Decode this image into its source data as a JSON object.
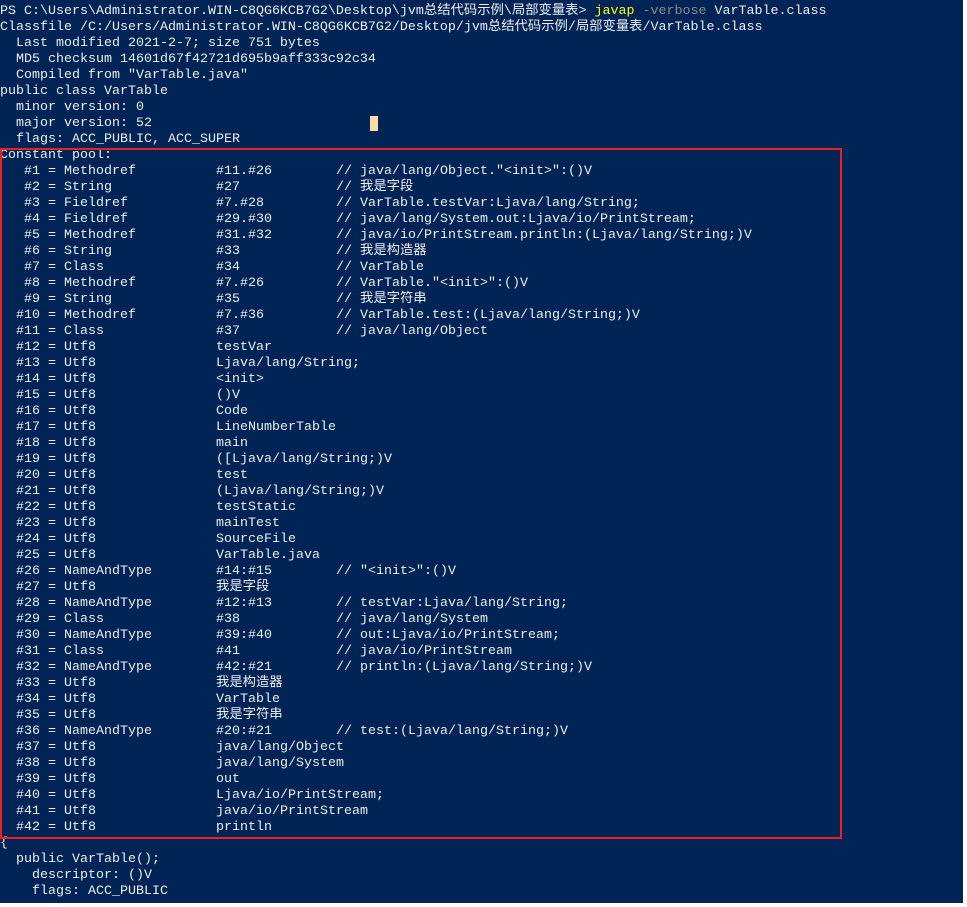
{
  "terminal": {
    "prompt": "PS C:\\Users\\Administrator.WIN-C8QG6KCB7G2\\Desktop\\jvm总结代码示例\\局部变量表> ",
    "command": "javap",
    "flag": "-verbose",
    "argument": "VarTable.class",
    "colors": {
      "background": "#012456",
      "command": "#ffff00",
      "flag": "#8a8a8a",
      "highlight_box": "#e8231f"
    },
    "header_lines": [
      "Classfile /C:/Users/Administrator.WIN-C8QG6KCB7G2/Desktop/jvm总结代码示例/局部变量表/VarTable.class",
      "  Last modified 2021-2-7; size 751 bytes",
      "  MD5 checksum 14601d67f42721d695b9aff333c92c34",
      "  Compiled from \"VarTable.java\"",
      "public class VarTable",
      "  minor version: 0",
      "  major version: 52",
      "  flags: ACC_PUBLIC, ACC_SUPER",
      "Constant pool:"
    ],
    "constant_pool": [
      {
        "idx": "#1",
        "type": "Methodref",
        "ref": "#11.#26",
        "comment": "// java/lang/Object.\"<init>\":()V"
      },
      {
        "idx": "#2",
        "type": "String",
        "ref": "#27",
        "comment": "// 我是字段"
      },
      {
        "idx": "#3",
        "type": "Fieldref",
        "ref": "#7.#28",
        "comment": "// VarTable.testVar:Ljava/lang/String;"
      },
      {
        "idx": "#4",
        "type": "Fieldref",
        "ref": "#29.#30",
        "comment": "// java/lang/System.out:Ljava/io/PrintStream;"
      },
      {
        "idx": "#5",
        "type": "Methodref",
        "ref": "#31.#32",
        "comment": "// java/io/PrintStream.println:(Ljava/lang/String;)V"
      },
      {
        "idx": "#6",
        "type": "String",
        "ref": "#33",
        "comment": "// 我是构造器"
      },
      {
        "idx": "#7",
        "type": "Class",
        "ref": "#34",
        "comment": "// VarTable"
      },
      {
        "idx": "#8",
        "type": "Methodref",
        "ref": "#7.#26",
        "comment": "// VarTable.\"<init>\":()V"
      },
      {
        "idx": "#9",
        "type": "String",
        "ref": "#35",
        "comment": "// 我是字符串"
      },
      {
        "idx": "#10",
        "type": "Methodref",
        "ref": "#7.#36",
        "comment": "// VarTable.test:(Ljava/lang/String;)V"
      },
      {
        "idx": "#11",
        "type": "Class",
        "ref": "#37",
        "comment": "// java/lang/Object"
      },
      {
        "idx": "#12",
        "type": "Utf8",
        "ref": "testVar",
        "comment": ""
      },
      {
        "idx": "#13",
        "type": "Utf8",
        "ref": "Ljava/lang/String;",
        "comment": ""
      },
      {
        "idx": "#14",
        "type": "Utf8",
        "ref": "<init>",
        "comment": ""
      },
      {
        "idx": "#15",
        "type": "Utf8",
        "ref": "()V",
        "comment": ""
      },
      {
        "idx": "#16",
        "type": "Utf8",
        "ref": "Code",
        "comment": ""
      },
      {
        "idx": "#17",
        "type": "Utf8",
        "ref": "LineNumberTable",
        "comment": ""
      },
      {
        "idx": "#18",
        "type": "Utf8",
        "ref": "main",
        "comment": ""
      },
      {
        "idx": "#19",
        "type": "Utf8",
        "ref": "([Ljava/lang/String;)V",
        "comment": ""
      },
      {
        "idx": "#20",
        "type": "Utf8",
        "ref": "test",
        "comment": ""
      },
      {
        "idx": "#21",
        "type": "Utf8",
        "ref": "(Ljava/lang/String;)V",
        "comment": ""
      },
      {
        "idx": "#22",
        "type": "Utf8",
        "ref": "testStatic",
        "comment": ""
      },
      {
        "idx": "#23",
        "type": "Utf8",
        "ref": "mainTest",
        "comment": ""
      },
      {
        "idx": "#24",
        "type": "Utf8",
        "ref": "SourceFile",
        "comment": ""
      },
      {
        "idx": "#25",
        "type": "Utf8",
        "ref": "VarTable.java",
        "comment": ""
      },
      {
        "idx": "#26",
        "type": "NameAndType",
        "ref": "#14:#15",
        "comment": "// \"<init>\":()V"
      },
      {
        "idx": "#27",
        "type": "Utf8",
        "ref": "我是字段",
        "comment": ""
      },
      {
        "idx": "#28",
        "type": "NameAndType",
        "ref": "#12:#13",
        "comment": "// testVar:Ljava/lang/String;"
      },
      {
        "idx": "#29",
        "type": "Class",
        "ref": "#38",
        "comment": "// java/lang/System"
      },
      {
        "idx": "#30",
        "type": "NameAndType",
        "ref": "#39:#40",
        "comment": "// out:Ljava/io/PrintStream;"
      },
      {
        "idx": "#31",
        "type": "Class",
        "ref": "#41",
        "comment": "// java/io/PrintStream"
      },
      {
        "idx": "#32",
        "type": "NameAndType",
        "ref": "#42:#21",
        "comment": "// println:(Ljava/lang/String;)V"
      },
      {
        "idx": "#33",
        "type": "Utf8",
        "ref": "我是构造器",
        "comment": ""
      },
      {
        "idx": "#34",
        "type": "Utf8",
        "ref": "VarTable",
        "comment": ""
      },
      {
        "idx": "#35",
        "type": "Utf8",
        "ref": "我是字符串",
        "comment": ""
      },
      {
        "idx": "#36",
        "type": "NameAndType",
        "ref": "#20:#21",
        "comment": "// test:(Ljava/lang/String;)V"
      },
      {
        "idx": "#37",
        "type": "Utf8",
        "ref": "java/lang/Object",
        "comment": ""
      },
      {
        "idx": "#38",
        "type": "Utf8",
        "ref": "java/lang/System",
        "comment": ""
      },
      {
        "idx": "#39",
        "type": "Utf8",
        "ref": "out",
        "comment": ""
      },
      {
        "idx": "#40",
        "type": "Utf8",
        "ref": "Ljava/io/PrintStream;",
        "comment": ""
      },
      {
        "idx": "#41",
        "type": "Utf8",
        "ref": "java/io/PrintStream",
        "comment": ""
      },
      {
        "idx": "#42",
        "type": "Utf8",
        "ref": "println",
        "comment": ""
      }
    ],
    "footer_lines": [
      "{",
      "  public VarTable();",
      "    descriptor: ()V",
      "    flags: ACC_PUBLIC"
    ]
  }
}
